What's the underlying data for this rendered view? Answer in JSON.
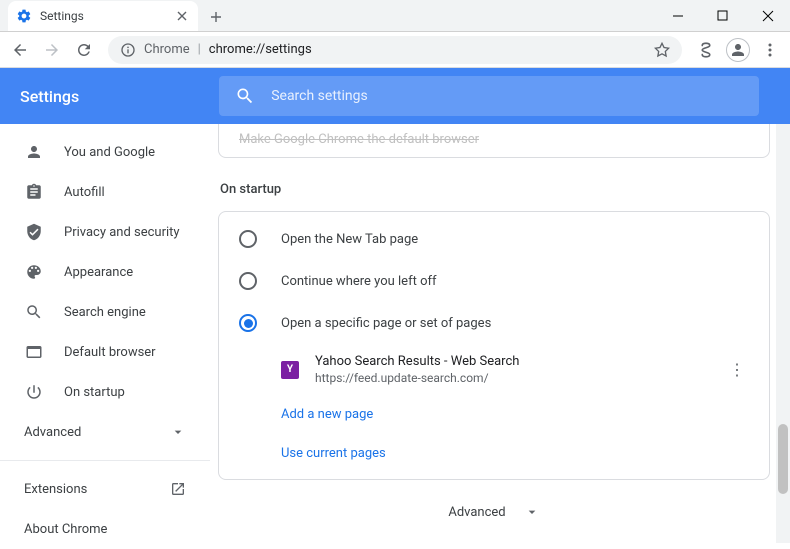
{
  "window": {
    "tab_title": "Settings",
    "omnibox_prefix": "Chrome",
    "omnibox_path": "chrome://settings"
  },
  "header": {
    "title": "Settings",
    "search_placeholder": "Search settings"
  },
  "sidebar": {
    "items": [
      {
        "label": "You and Google",
        "icon": "person"
      },
      {
        "label": "Autofill",
        "icon": "autofill"
      },
      {
        "label": "Privacy and security",
        "icon": "security"
      },
      {
        "label": "Appearance",
        "icon": "appearance"
      },
      {
        "label": "Search engine",
        "icon": "search"
      },
      {
        "label": "Default browser",
        "icon": "browser"
      },
      {
        "label": "On startup",
        "icon": "power"
      }
    ],
    "advanced": "Advanced",
    "extensions": "Extensions",
    "about": "About Chrome"
  },
  "content": {
    "truncated_card": "Make Google Chrome the default browser",
    "section_title": "On startup",
    "radios": [
      {
        "label": "Open the New Tab page",
        "checked": false
      },
      {
        "label": "Continue where you left off",
        "checked": false
      },
      {
        "label": "Open a specific page or set of pages",
        "checked": true
      }
    ],
    "startup_page": {
      "title": "Yahoo Search Results - Web Search",
      "url": "https://feed.update-search.com/",
      "favicon_letter": "Y"
    },
    "add_page": "Add a new page",
    "use_current": "Use current pages",
    "bottom_advanced": "Advanced"
  }
}
